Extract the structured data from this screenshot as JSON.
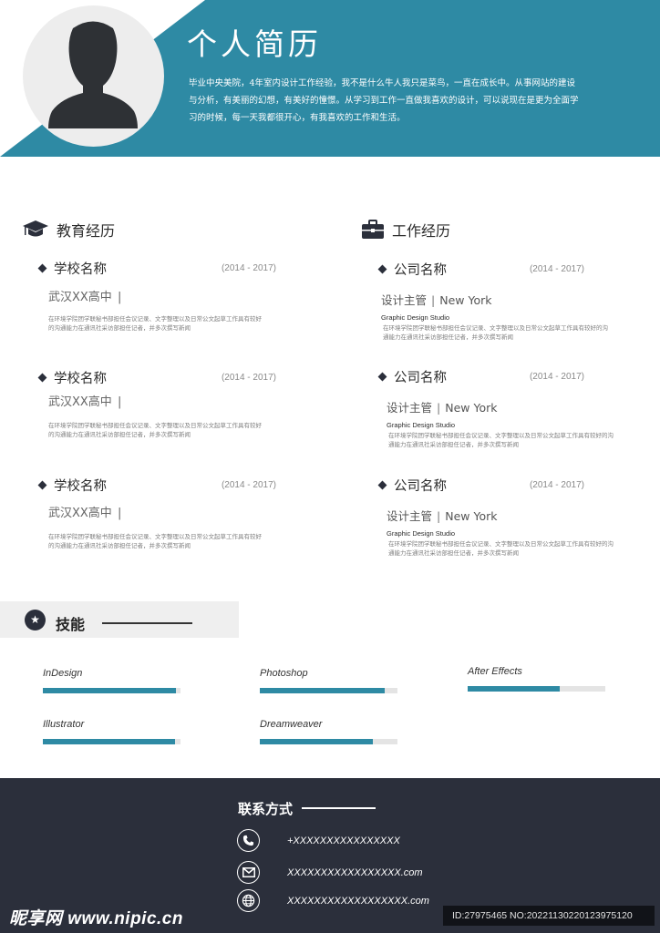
{
  "colors": {
    "accent": "#2e8aa4",
    "dark": "#2b2f3b",
    "band": "#efefef"
  },
  "header": {
    "title": "个人简历",
    "intro": "毕业中央美院，4年室内设计工作经验，我不是什么牛人我只是菜鸟，一直在成长中。从事网站的建设与分析，有美丽的幻想，有美好的憧憬。从学习到工作一直做我喜欢的设计，可以说现在是更为全面学习的时候，每一天我都很开心，有我喜欢的工作和生活。",
    "avatar_icon": "user-silhouette-icon"
  },
  "education": {
    "title": "教育经历",
    "icon": "graduation-cap-icon",
    "items": [
      {
        "name": "学校名称",
        "dates": "(2014 - 2017)",
        "school": "武汉XX高中",
        "desc": "在环境学院团学联秘书部担任会议记录、文字整理以及日常公文起草工作具有较好的沟通能力在通讯社采访部担任记者，并多次撰写新闻"
      },
      {
        "name": "学校名称",
        "dates": "(2014 - 2017)",
        "school": "武汉XX高中",
        "desc": "在环境学院团学联秘书部担任会议记录、文字整理以及日常公文起草工作具有较好的沟通能力在通讯社采访部担任记者，并多次撰写新闻"
      },
      {
        "name": "学校名称",
        "dates": "(2014 - 2017)",
        "school": "武汉XX高中",
        "desc": "在环境学院团学联秘书部担任会议记录、文字整理以及日常公文起草工作具有较好的沟通能力在通讯社采访部担任记者，并多次撰写新闻"
      }
    ]
  },
  "work": {
    "title": "工作经历",
    "icon": "briefcase-icon",
    "items": [
      {
        "name": "公司名称",
        "dates": "(2014 - 2017)",
        "role": "设计主管",
        "city": "New York",
        "studio": "Graphic Design Studio",
        "desc": "在环境学院团学联秘书部担任会议记录、文字整理以及日常公文起草工作具有较好的沟通能力在通讯社采访部担任记者，并多次撰写新闻"
      },
      {
        "name": "公司名称",
        "dates": "(2014 - 2017)",
        "role": "设计主管",
        "city": "New York",
        "studio": "Graphic Design Studio",
        "desc": "在环境学院团学联秘书部担任会议记录、文字整理以及日常公文起草工作具有较好的沟通能力在通讯社采访部担任记者，并多次撰写新闻"
      },
      {
        "name": "公司名称",
        "dates": "(2014 - 2017)",
        "role": "设计主管",
        "city": "New York",
        "studio": "Graphic Design Studio",
        "desc": "在环境学院团学联秘书部担任会议记录、文字整理以及日常公文起草工作具有较好的沟通能力在通讯社采访部担任记者，并多次撰写新闻"
      }
    ]
  },
  "skills": {
    "title": "技能",
    "icon": "star-icon",
    "items": [
      {
        "name": "InDesign",
        "level": 0.97
      },
      {
        "name": "Photoshop",
        "level": 0.91
      },
      {
        "name": "After Effects",
        "level": 0.67
      },
      {
        "name": "Illustrator",
        "level": 0.96
      },
      {
        "name": "Dreamweaver",
        "level": 0.82
      }
    ]
  },
  "contact": {
    "title": "联系方式",
    "phone": "+XXXXXXXXXXXXXXXX",
    "email": "XXXXXXXXXXXXXXXXX.com",
    "web": "XXXXXXXXXXXXXXXXXX.com",
    "icons": [
      "phone-icon",
      "mail-icon",
      "globe-icon"
    ]
  },
  "watermark": {
    "site": "昵享网 www.nipic.cn",
    "id": "ID:27975465 NO:20221130220123975120"
  }
}
